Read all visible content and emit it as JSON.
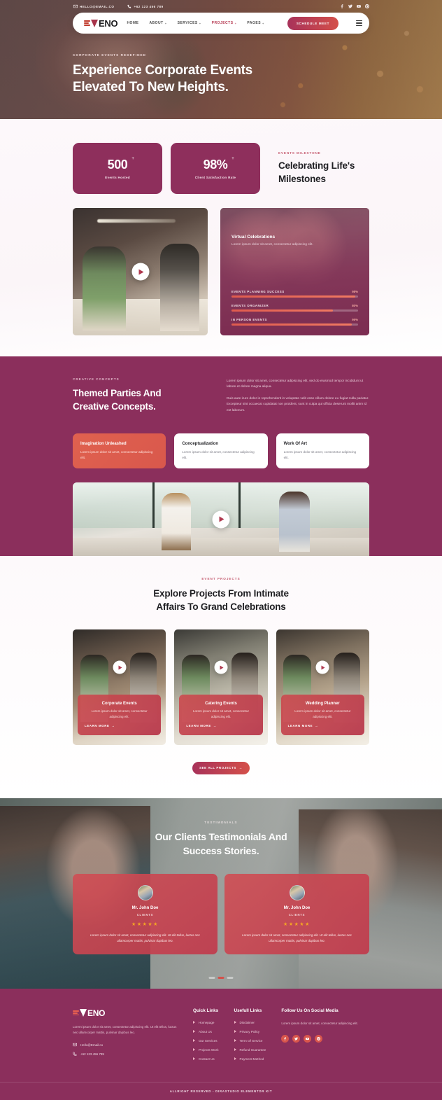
{
  "topbar": {
    "email": "HELLO@EMAIL.CO",
    "phone": "+62 123 456 789",
    "socials": [
      "facebook-icon",
      "twitter-icon",
      "youtube-icon",
      "pinterest-icon"
    ]
  },
  "nav": {
    "logo": "ENO",
    "links": [
      {
        "label": "HOME",
        "caret": "",
        "active": false
      },
      {
        "label": "ABOUT",
        "caret": "+",
        "active": false
      },
      {
        "label": "SERVICES",
        "caret": "+",
        "active": false
      },
      {
        "label": "PROJECTS",
        "caret": "+",
        "active": true
      },
      {
        "label": "PAGES",
        "caret": "+",
        "active": false
      }
    ],
    "cta": "SCHEDULE MEET"
  },
  "hero": {
    "eyebrow": "CORPORATE EVENTS REDEFINED",
    "title_line1": "Experience Corporate Events",
    "title_line2": "Elevated To New Heights."
  },
  "milestone": {
    "eyebrow": "EVENTS MILESTONE",
    "title_line1": "Celebrating Life's",
    "title_line2": "Milestones",
    "stats": [
      {
        "value": "500",
        "suffix": "+",
        "label": "Events Hosted"
      },
      {
        "value": "98%",
        "suffix": "+",
        "label": "Client Satisfaction Rate"
      }
    ],
    "card": {
      "title": "Virtual Celebrations",
      "subtitle": "Lorem ipsum dolor sit amet, consectetur adipiscing elit.",
      "bars": [
        {
          "label": "EVENTS PLANNING SUCCESS",
          "pct": "98%",
          "value": 98
        },
        {
          "label": "EVENTS ORGANIZER",
          "pct": "80%",
          "value": 80
        },
        {
          "label": "IN PERSON EVENTS",
          "pct": "95%",
          "value": 95
        }
      ]
    }
  },
  "creative": {
    "eyebrow": "CREATIVE CONCEPTS",
    "title_line1": "Themed Parties And",
    "title_line2": "Creative Concepts.",
    "paragraph1": "Lorem ipsum dolor sit amet, consectetur adipiscing elit, sed do eiusmod tempor incididunt ut labore et dolore magna aliqua.",
    "paragraph2": "Duis aute irure dolor in reprehenderit in voluptate velit esse cillum dolore eu fugiat nulla pariatur. Excepteur sint occaecat cupidatat non proident, sunt in culpa qui officia deserunt mollit anim id est laborum.",
    "cards": [
      {
        "title": "Imagination Unleashed",
        "text": "Lorem ipsum dolor sit amet, consectetur adipiscing elit."
      },
      {
        "title": "Conceptualization",
        "text": "Lorem ipsum dolor sit amet, consectetur adipiscing elit."
      },
      {
        "title": "Work Of Art",
        "text": "Lorem ipsum dolor sit amet, consectetur adipiscing elit."
      }
    ]
  },
  "projects": {
    "eyebrow": "EVENT PROJECTS",
    "title_line1": "Explore Projects From Intimate",
    "title_line2": "Affairs To Grand Celebrations",
    "items": [
      {
        "title": "Corporate Events",
        "text": "Lorem ipsum dolor sit amet, consectetur adipiscing elit.",
        "link": "LEARN MORE"
      },
      {
        "title": "Catering Events",
        "text": "Lorem ipsum dolor sit amet, consectetur adipiscing elit.",
        "link": "LEARN MORE"
      },
      {
        "title": "Wedding Planner",
        "text": "Lorem ipsum dolor sit amet, consectetur adipiscing elit.",
        "link": "LEARN MORE"
      }
    ],
    "cta": "SEE ALL PROJECTS"
  },
  "testimonials": {
    "eyebrow": "TESTIMONIALS",
    "title_line1": "Our Clients Testimonials And",
    "title_line2": "Success Stories.",
    "items": [
      {
        "name": "Mr. John Doe",
        "role": "CLIENTS",
        "stars": "★★★★★",
        "text": "Lorem ipsum dolor sit amet, consectetur adipiscing elit. Ut elit tellus, luctus nec ullamcorper mattis, pulvinar dapibus leo."
      },
      {
        "name": "Mr. John Doe",
        "role": "CLIENTS",
        "stars": "★★★★★",
        "text": "Lorem ipsum dolor sit amet, consectetur adipiscing elit. Ut elit tellus, luctus nec ullamcorper mattis, pulvinar dapibus leo."
      }
    ]
  },
  "footer": {
    "logo": "ENO",
    "about": "Lorem ipsum dolor sit amet, consectetur adipiscing elit. Ut elit tellus, luctus nec ullamcorper mattis, pulvinar dapibus leo.",
    "email": "Hello@Email.co",
    "phone": "+62 123 456 789",
    "quick_links_title": "Quick Links",
    "quick_links": [
      "Homepage",
      "About Us",
      "Our Services",
      "Projects Work",
      "Contact Us"
    ],
    "useful_links_title": "Usefull Links",
    "useful_links": [
      "Disclaimer",
      "Privacy Policy",
      "Term Of Service",
      "Refund Guarantee",
      "Payment Method"
    ],
    "social_title": "Follow Us On Social Media",
    "social_text": "Lorem ipsum dolor sit amet, consectetur adipiscing elit.",
    "socials": [
      "facebook-icon",
      "twitter-icon",
      "youtube-icon",
      "pinterest-icon"
    ],
    "copyright": "ALLRIGHT RESERVED - DIRASTUDIO ELEMENTOR KIT"
  },
  "colors": {
    "brand_maroon": "#8b2f5c",
    "accent_red": "#d4504a",
    "gradient_start": "#a8325a",
    "star": "#f5a623"
  }
}
